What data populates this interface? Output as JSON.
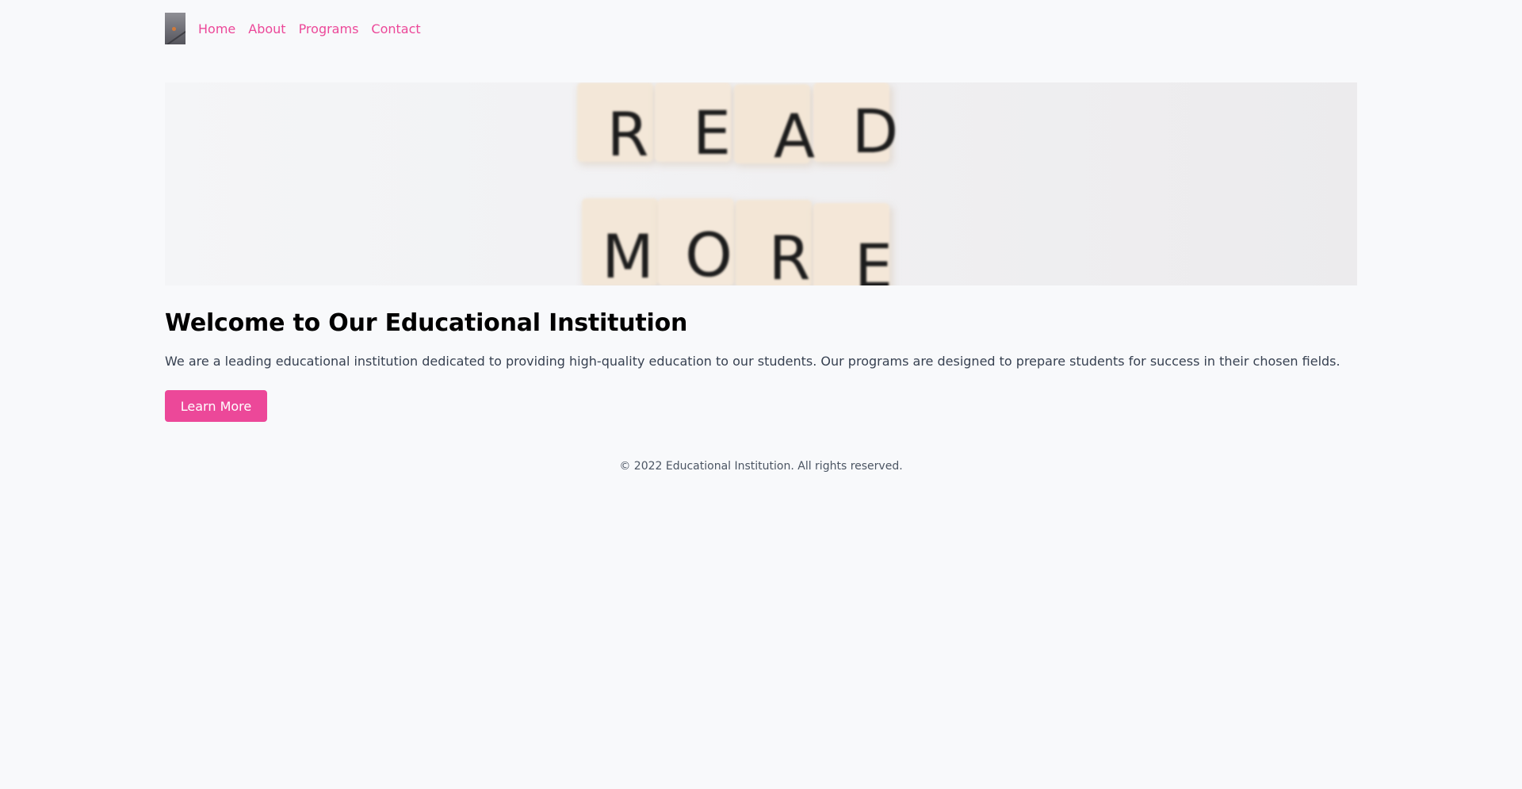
{
  "nav": {
    "logo_icon": "logo-icon",
    "links": [
      {
        "label": "Home"
      },
      {
        "label": "About"
      },
      {
        "label": "Programs"
      },
      {
        "label": "Contact"
      }
    ]
  },
  "hero": {
    "tiles_top": [
      "R",
      "E",
      "A",
      "D"
    ],
    "tiles_bottom": [
      "M",
      "O",
      "R",
      "E"
    ]
  },
  "main": {
    "title": "Welcome to Our Educational Institution",
    "description": "We are a leading educational institution dedicated to providing high-quality education to our students. Our programs are designed to prepare students for success in their chosen fields.",
    "cta_label": "Learn More"
  },
  "footer": {
    "text": "© 2022 Educational Institution. All rights reserved."
  },
  "colors": {
    "accent": "#ec4899",
    "background": "#f8f9fb",
    "text": "#374151"
  }
}
